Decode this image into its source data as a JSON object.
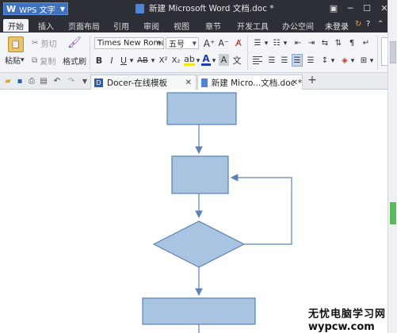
{
  "titlebar": {
    "app_label": "WPS 文字",
    "app_logo": "W",
    "doc_title": "新建 Microsoft Word 文档.doc *"
  },
  "menu": {
    "tabs": [
      "开始",
      "插入",
      "页面布局",
      "引用",
      "审阅",
      "视图",
      "章节",
      "开发工具",
      "办公空间"
    ],
    "active_tab": "开始",
    "login_label": "未登录"
  },
  "ribbon": {
    "paste_label": "粘贴",
    "cut_label": "剪切",
    "copy_label": "复制",
    "format_painter_label": "格式刷",
    "font_name": "Times New Roma",
    "font_size": "五号",
    "bold": "B",
    "italic": "I",
    "underline": "U",
    "strike": "AB",
    "superscript": "X²",
    "subscript": "X₂",
    "font_color_letter": "A",
    "grow_font": "A⁺",
    "shrink_font": "A⁻",
    "char_shade": "A",
    "phonetic": "文"
  },
  "quickbar": {
    "tabs": [
      {
        "label": "Docer-在线模板"
      },
      {
        "label": "新建 Micro...文档.doc *"
      }
    ],
    "new_tab_symbol": "+"
  },
  "watermark": {
    "line1": "无忧电脑学习网",
    "line2": "wypcw.com"
  },
  "colors": {
    "titlebar_bg": "#2c2f36",
    "ribbon_bg": "#f2f4f7",
    "flow_shape_fill": "#a8c4e0",
    "flow_shape_stroke": "#5a82b4",
    "accent": "#3f73c0"
  }
}
